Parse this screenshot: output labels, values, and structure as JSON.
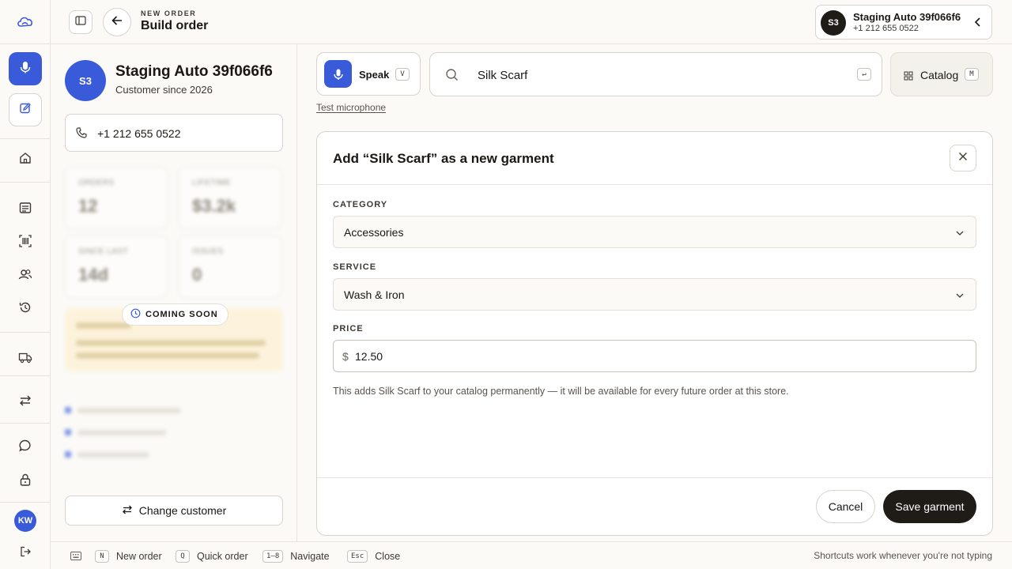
{
  "header": {
    "eyebrow": "NEW ORDER",
    "title": "Build order",
    "customer_chip": {
      "initials": "S3",
      "name": "Staging Auto 39f066f6",
      "phone": "+1 212 655 0522"
    }
  },
  "customer": {
    "initials": "S3",
    "name": "Staging Auto 39f066f6",
    "since": "Customer since 2026",
    "phone": "+1 212 655 0522",
    "stats": [
      {
        "label": "ORDERS",
        "value": "12"
      },
      {
        "label": "LIFETIME",
        "value": "$3.2k"
      },
      {
        "label": "SINCE LAST",
        "value": "14d"
      },
      {
        "label": "ISSUES",
        "value": "0"
      }
    ],
    "coming_soon": "COMING SOON",
    "change_button": "Change customer"
  },
  "rail": {
    "user_initials": "KW"
  },
  "toolbar": {
    "speak_label": "Speak",
    "speak_key": "V",
    "search_value": "Silk Scarf",
    "enter_key": "↵",
    "catalog_label": "Catalog",
    "catalog_key": "M",
    "test_mic": "Test microphone"
  },
  "modal": {
    "title": "Add “Silk Scarf” as a new garment",
    "category_label": "CATEGORY",
    "category_value": "Accessories",
    "service_label": "SERVICE",
    "service_value": "Wash & Iron",
    "price_label": "PRICE",
    "currency": "$",
    "price_value": "12.50",
    "note": "This adds Silk Scarf to your catalog permanently — it will be available for every future order at this store.",
    "cancel": "Cancel",
    "save": "Save garment"
  },
  "shortcuts": {
    "items": [
      {
        "key": "N",
        "label": "New order"
      },
      {
        "key": "Q",
        "label": "Quick order"
      },
      {
        "key": "1–8",
        "label": "Navigate"
      },
      {
        "key": "Esc",
        "label": "Close"
      }
    ],
    "hint": "Shortcuts work whenever you're not typing"
  },
  "colors": {
    "accent": "#3a5bd9",
    "dark": "#1f1b17",
    "background": "#fbfaf7",
    "coming_soon_bg": "#fdf3dc"
  }
}
